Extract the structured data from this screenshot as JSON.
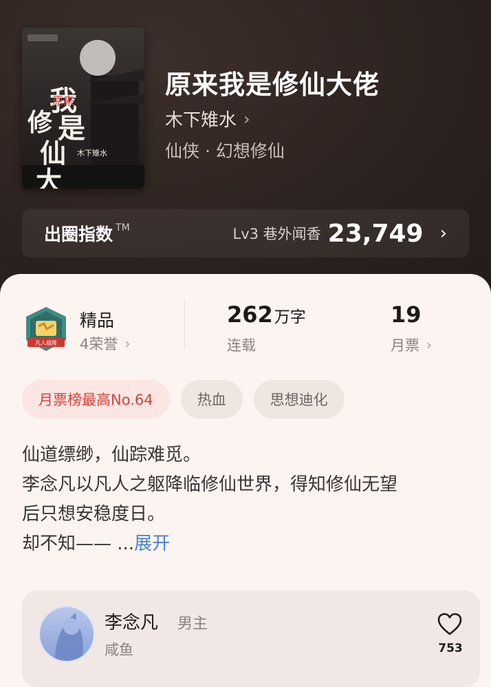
{
  "book": {
    "title": "原来我是修仙大佬",
    "author": "木下雉水",
    "author_chevron": "›",
    "genre": "仙侠 · 幻想修仙",
    "cover": {
      "title_text": "原来我是修仙大佬",
      "author_text": "木下雉水作品"
    }
  },
  "index": {
    "label": "出圈指数",
    "tm": "TM",
    "level": "Lv3 巷外闻香",
    "score": "23,749",
    "chevron": "›"
  },
  "stats": {
    "quality": {
      "label": "精品",
      "sub": "4荣誉",
      "badge_text": "凡人组阵"
    },
    "words": {
      "value": "262",
      "unit": "万字",
      "sub": "连载"
    },
    "votes": {
      "value": "19",
      "sub": "月票"
    }
  },
  "tags": [
    "月票榜最高No.64",
    "热血",
    "思想迪化"
  ],
  "description": {
    "lines": [
      "仙道缥缈，仙踪难觅。",
      "李念凡以凡人之躯降临修仙世界，得知修仙无望",
      "后只想安稳度日。"
    ],
    "last_line": "却不知—— ...",
    "expand_label": "展开"
  },
  "character": {
    "name": "李念凡",
    "role": "男主",
    "sub": "咸鱼",
    "likes": "753",
    "icon": "heart-icon"
  },
  "colors": {
    "accent_red": "#d4443b",
    "link_blue": "#4a83d2",
    "header_bg": "#2b2220",
    "sheet_bg": "#fbf4f1"
  }
}
